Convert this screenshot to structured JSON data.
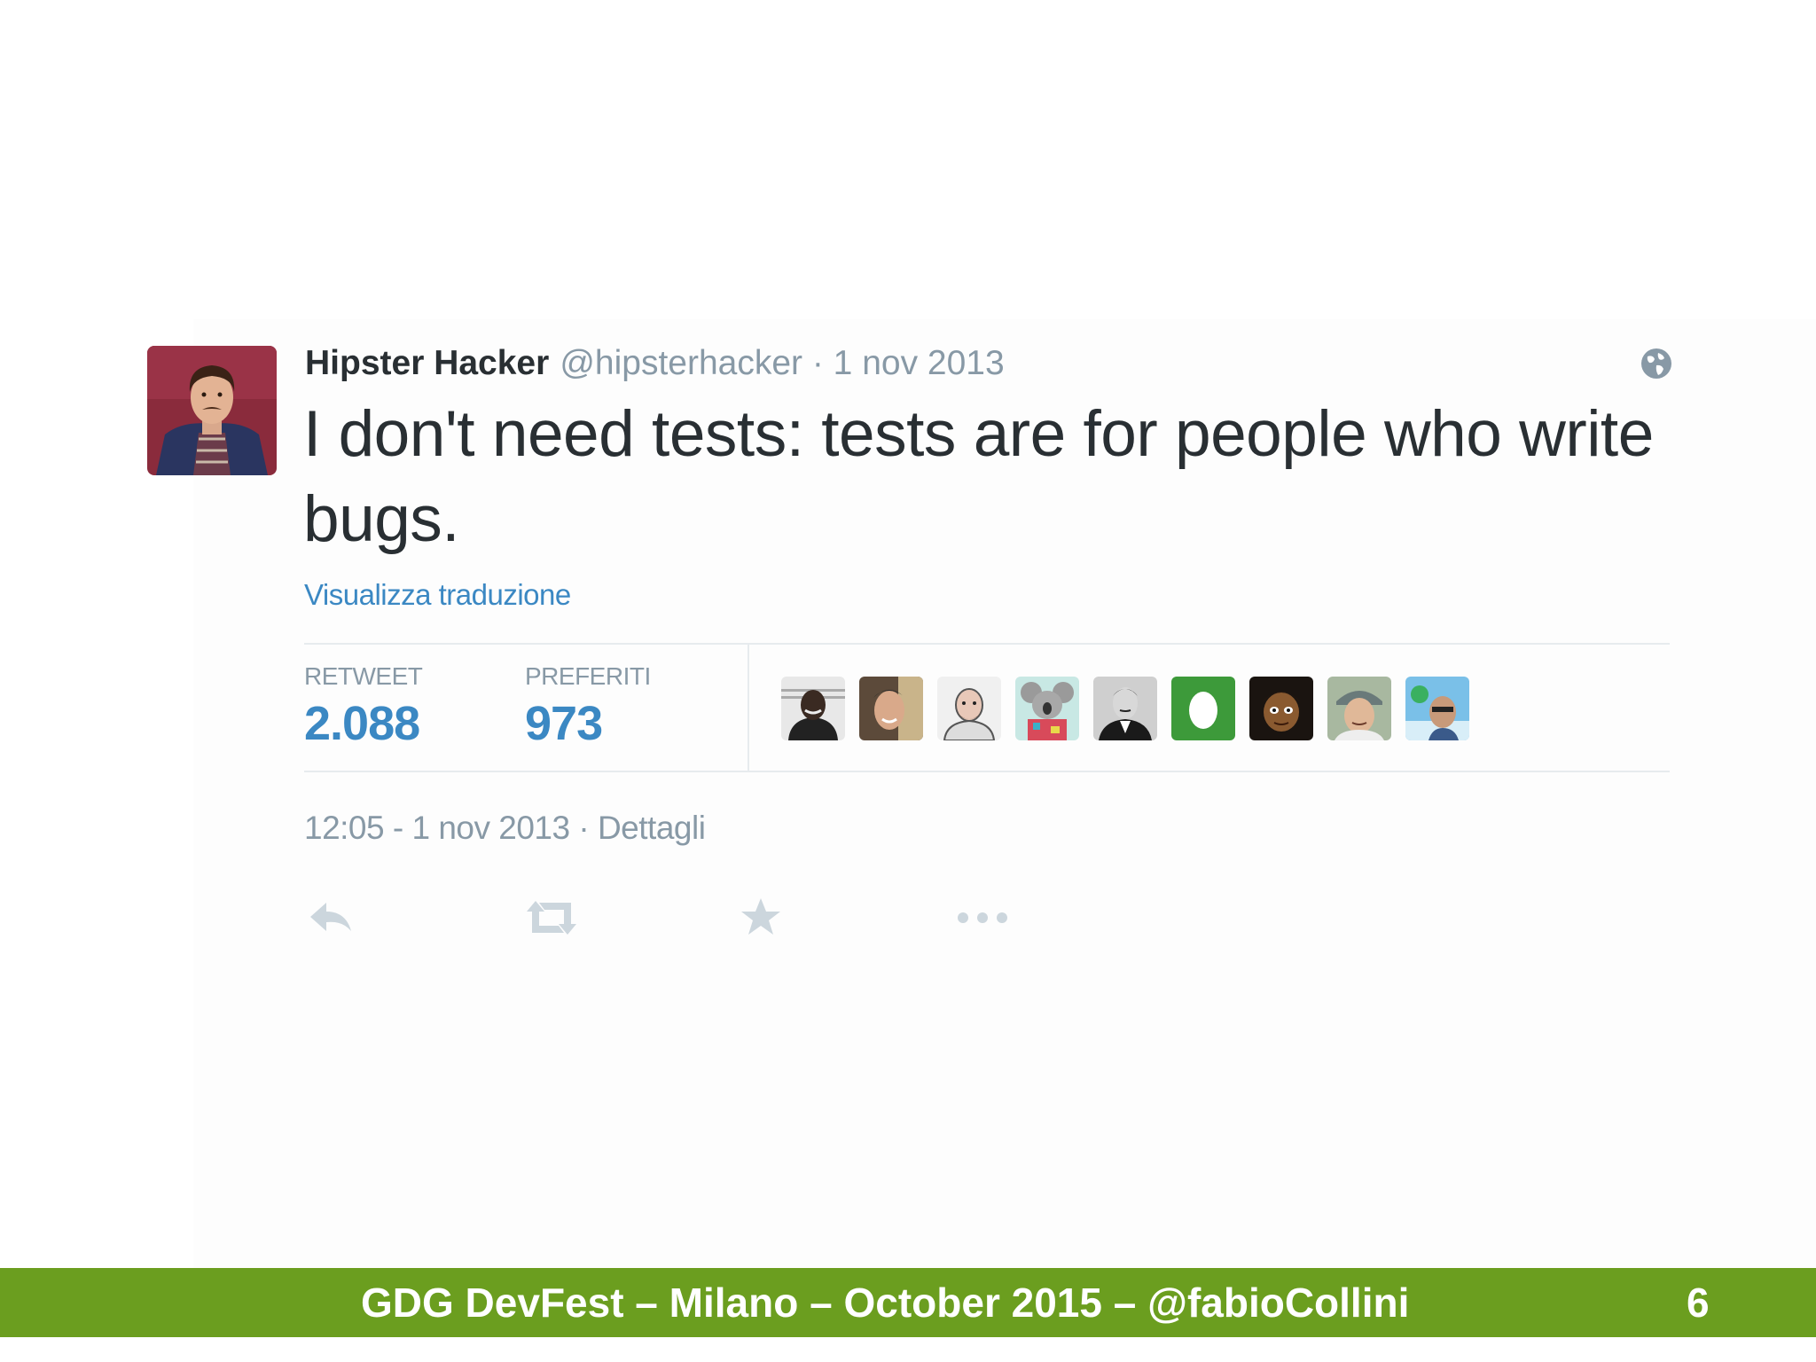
{
  "tweet": {
    "author_name": "Hipster Hacker",
    "author_meta": "@hipsterhacker · 1 nov 2013",
    "text": "I don't need tests:  tests are for people who write bugs.",
    "translate_link": "Visualizza traduzione",
    "stats": {
      "retweet_label": "RETWEET",
      "retweet_count": "2.088",
      "favorites_label": "PREFERITI",
      "favorites_count": "973"
    },
    "favoriters": [
      {
        "name": "favoriter-1"
      },
      {
        "name": "favoriter-2"
      },
      {
        "name": "favoriter-3"
      },
      {
        "name": "favoriter-4"
      },
      {
        "name": "favoriter-5"
      },
      {
        "name": "favoriter-6"
      },
      {
        "name": "favoriter-7"
      },
      {
        "name": "favoriter-8"
      },
      {
        "name": "favoriter-9"
      }
    ],
    "timestamp": "12:05 - 1 nov 2013 · Dettagli",
    "actions": [
      "reply-icon",
      "retweet-icon",
      "favorite-icon",
      "more-icon"
    ],
    "icons": {
      "globe": "globe-icon"
    }
  },
  "footer": {
    "text": "GDG DevFest – Milano – October 2015 – @fabioCollini",
    "page_number": "6"
  },
  "colors": {
    "link": "#3b88c3",
    "text": "#292f33",
    "muted": "#8899a6",
    "footer_bg": "#6b9e1f",
    "divider": "#e7ebee"
  }
}
